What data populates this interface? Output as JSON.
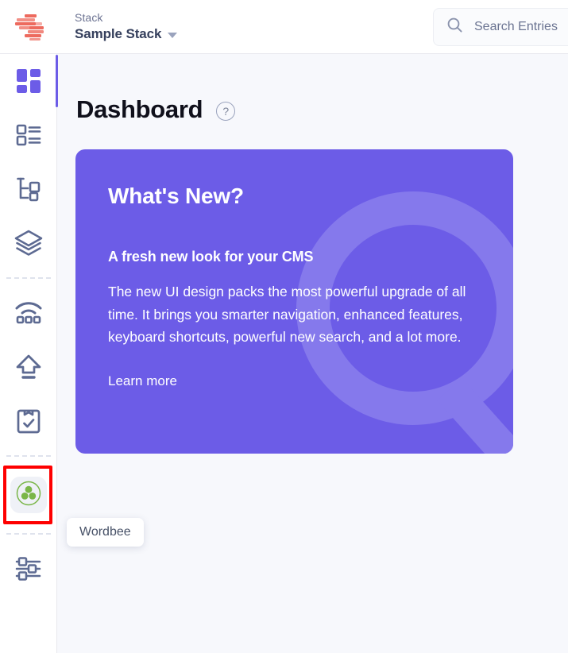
{
  "header": {
    "logo_icon": "contentstack-logo-icon",
    "stack_label": "Stack",
    "stack_name": "Sample Stack",
    "caret_icon": "chevron-down-icon"
  },
  "search": {
    "icon": "search-icon",
    "placeholder": "Search Entries",
    "value": "Search Entries"
  },
  "sidebar": {
    "items": [
      {
        "name": "dashboard",
        "icon": "grid-dashboard-icon",
        "active": true
      },
      {
        "name": "entries",
        "icon": "list-entries-icon",
        "active": false
      },
      {
        "name": "content-models",
        "icon": "content-model-tree-icon",
        "active": false
      },
      {
        "name": "assets",
        "icon": "layers-stack-icon",
        "active": false
      },
      {
        "name": "publish-queue",
        "icon": "broadcast-wifi-icon",
        "active": false
      },
      {
        "name": "releases",
        "icon": "upload-arrow-icon",
        "active": false
      },
      {
        "name": "audit-log",
        "icon": "clipboard-check-icon",
        "active": false
      }
    ],
    "app_item": {
      "name": "wordbee",
      "icon": "wordbee-three-dots-circle-icon",
      "tooltip": "Wordbee",
      "highlighted": true,
      "highlight_color": "#fe0000"
    },
    "settings_item": {
      "name": "settings",
      "icon": "sliders-settings-icon"
    }
  },
  "main": {
    "page_title": "Dashboard",
    "help_icon": "help-question-icon",
    "help_glyph": "?",
    "promo": {
      "heading": "What's New?",
      "subheading": "A fresh new look for your CMS",
      "body": "The new UI design packs the most powerful upgrade of all time. It brings you smarter navigation, enhanced features, keyboard shortcuts, powerful new search, and a lot more.",
      "link": "Learn more",
      "background_color": "#6c5ce7"
    }
  },
  "colors": {
    "accent_purple": "#6c5ce7",
    "canvas": "#f7f8fc",
    "rail_icon": "#5d6a92",
    "logo_red": "#ed6a5e",
    "wordbee_green": "#7ab648",
    "highlight_red": "#fe0000"
  }
}
